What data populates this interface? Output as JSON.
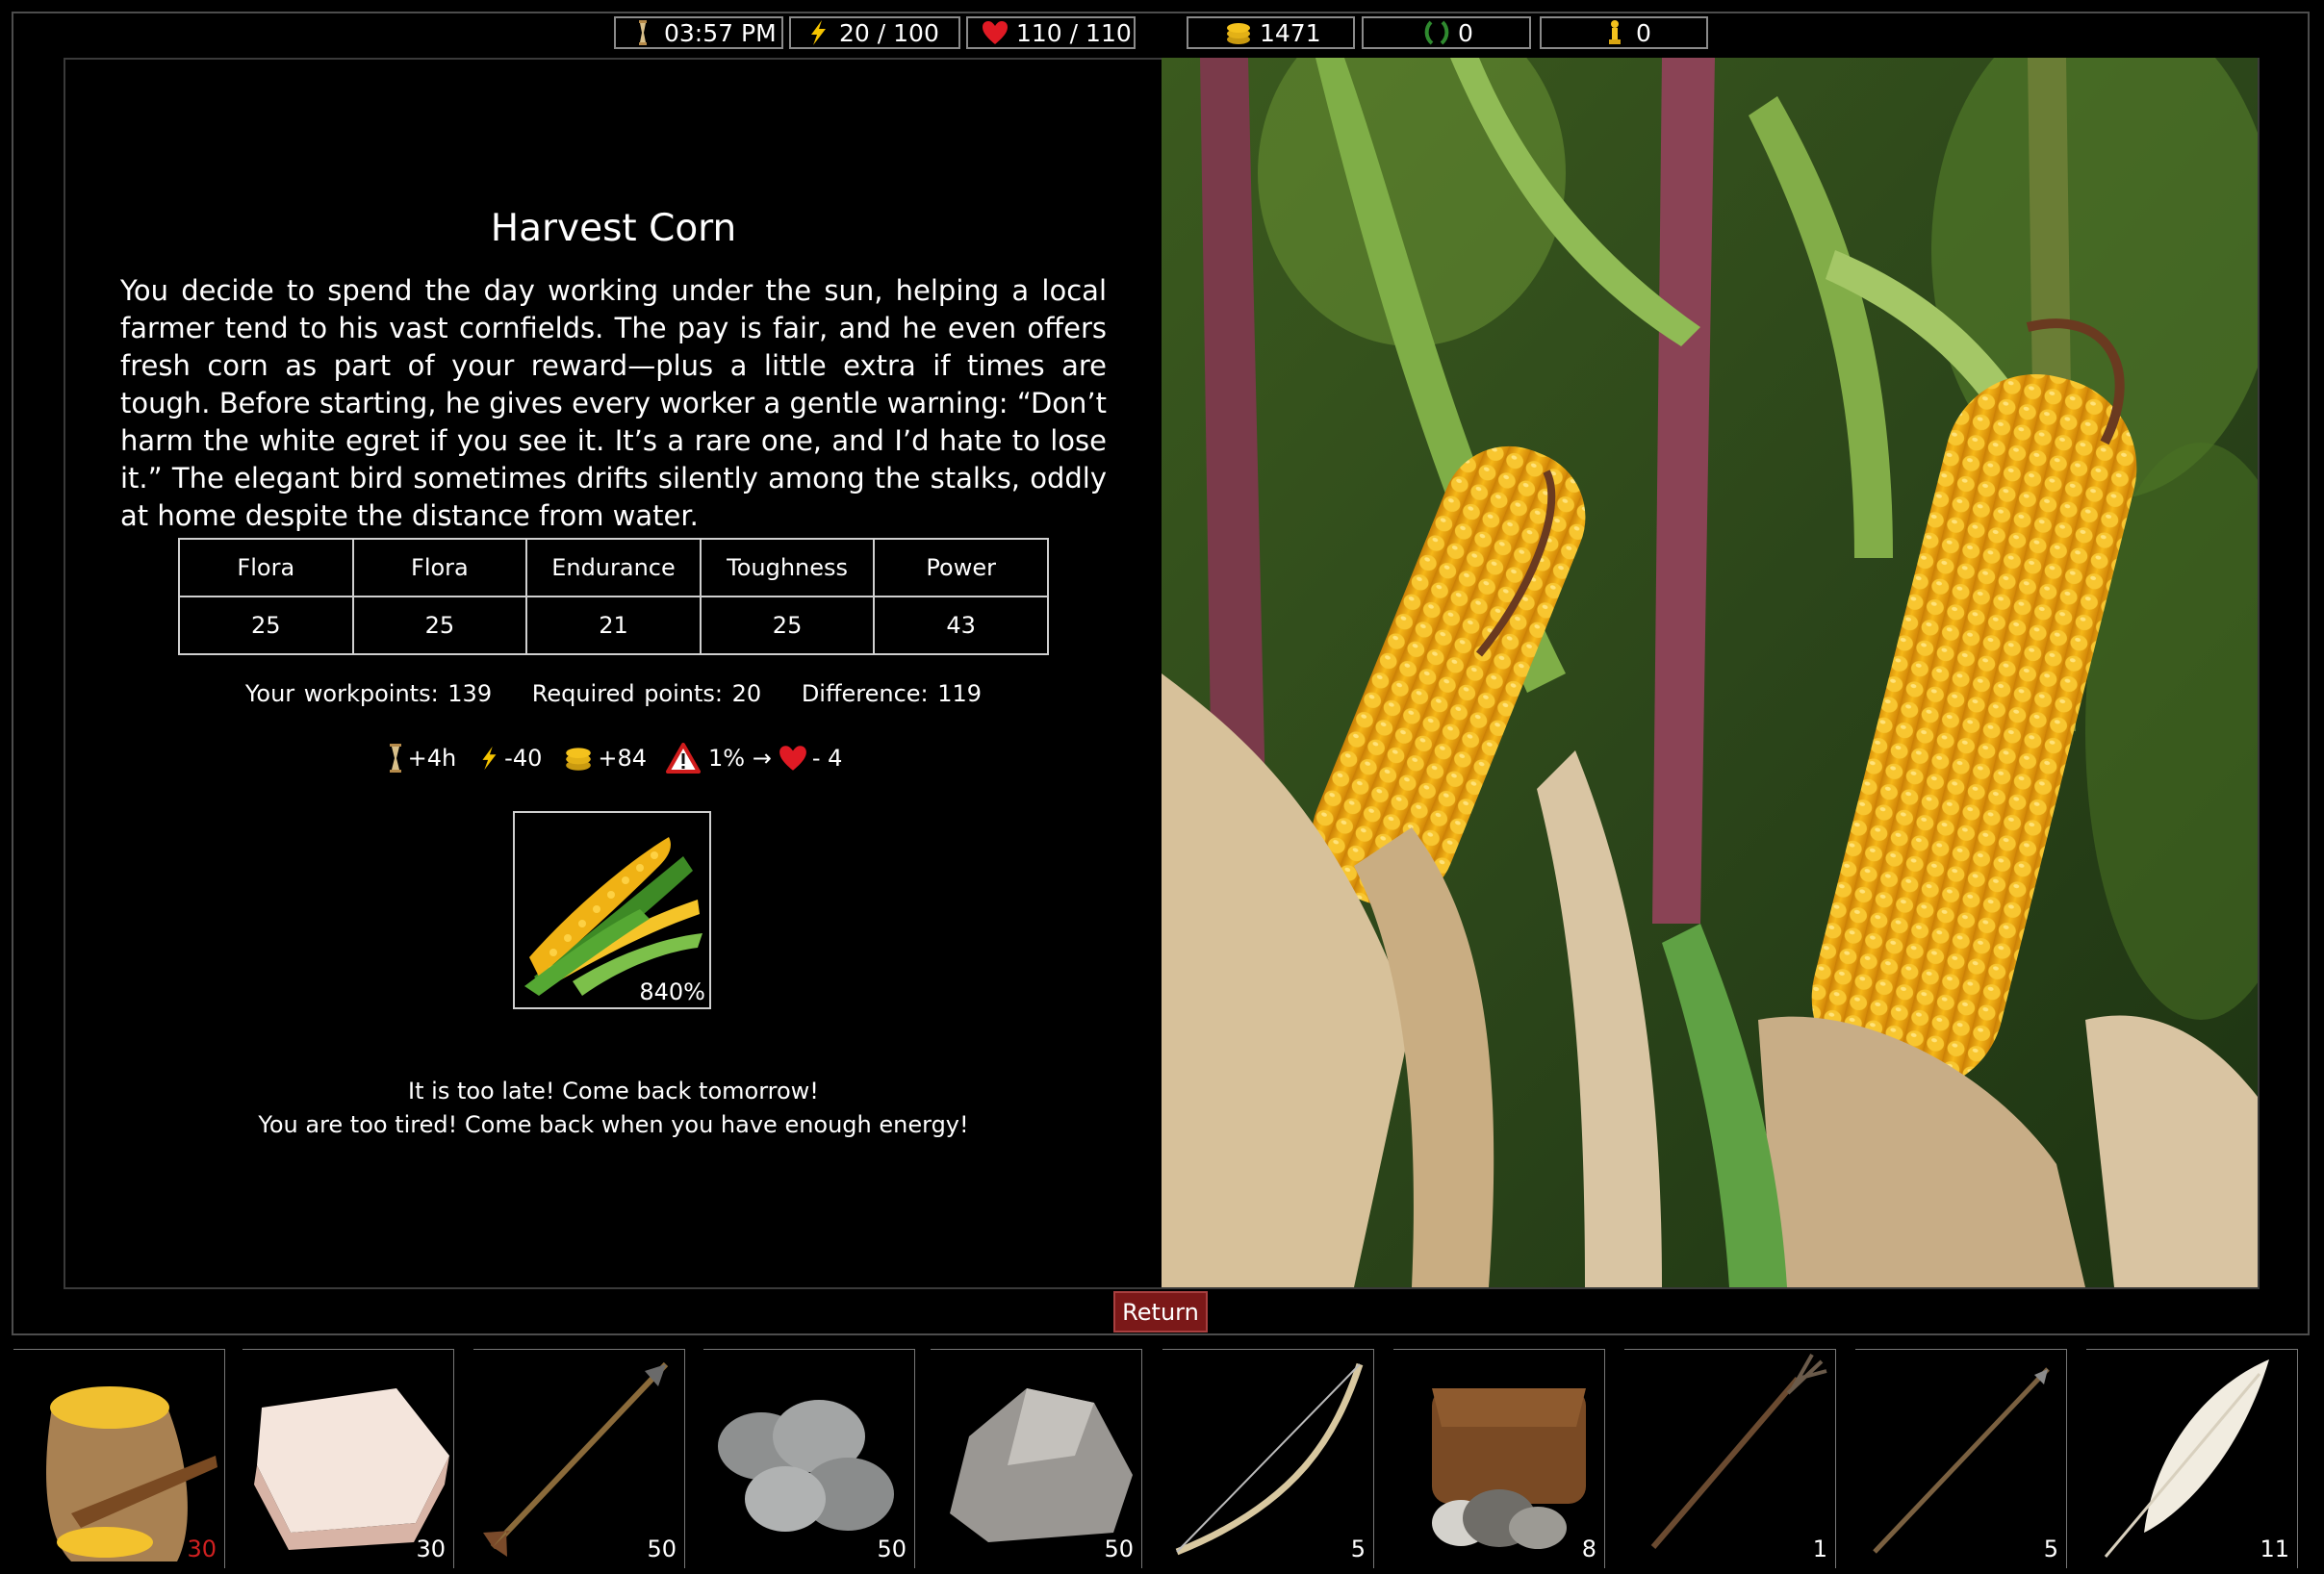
{
  "status_bar": {
    "time": "03:57 PM",
    "energy": "20 / 100",
    "health": "110 / 110",
    "coins": "1471",
    "laurels": "0",
    "trophies": "0",
    "icons": [
      "hourglass-icon",
      "lightning-icon",
      "heart-icon",
      "coins-icon",
      "laurel-icon",
      "trophy-icon"
    ]
  },
  "event": {
    "title": "Harvest Corn",
    "description": "You decide to spend the day working under the sun, helping a local farmer tend to his vast cornfields. The pay is fair, and he even offers fresh corn as part of your reward—plus a little extra if times are tough. Before starting, he gives every worker a gentle warning: “Don’t harm the white egret if you see it. It’s a rare one, and I’d hate to lose it.” The elegant bird sometimes drifts silently among the stalks, oddly at home despite the distance from water.",
    "stats": {
      "headers": [
        "Flora",
        "Flora",
        "Endurance",
        "Toughness",
        "Power"
      ],
      "values": [
        "25",
        "25",
        "21",
        "25",
        "43"
      ]
    },
    "points": {
      "workpoints": "Your workpoints: 139",
      "required": "Required points: 20",
      "difference": "Difference: 119"
    },
    "effects": {
      "time": "+4h",
      "energy": "-40",
      "coins": "+84",
      "risk": "1% →",
      "health": "- 4"
    },
    "reward": {
      "item": "corn-cobs",
      "percent": "840%"
    },
    "messages": [
      "It is too late! Come back tomorrow!",
      "You are too tired! Come back when you have enough energy!"
    ]
  },
  "return_label": "Return",
  "inventory": [
    {
      "item": "cornmeal-sack",
      "qty": "30",
      "low": true
    },
    {
      "item": "lard",
      "qty": "30"
    },
    {
      "item": "arrow",
      "qty": "50"
    },
    {
      "item": "pebbles",
      "qty": "50"
    },
    {
      "item": "rock",
      "qty": "50"
    },
    {
      "item": "bow",
      "qty": "5"
    },
    {
      "item": "satchel-with-stones",
      "qty": "8"
    },
    {
      "item": "pitchfork",
      "qty": "1"
    },
    {
      "item": "spear",
      "qty": "5"
    },
    {
      "item": "feather",
      "qty": "11"
    }
  ],
  "colors": {
    "return_bg": "#7b1818",
    "panel_border": "#3a3a3a",
    "low_qty": "#d02020",
    "corn_yellow": "#f2b417",
    "heart_red": "#e01a24",
    "gold": "#f4c21d"
  }
}
